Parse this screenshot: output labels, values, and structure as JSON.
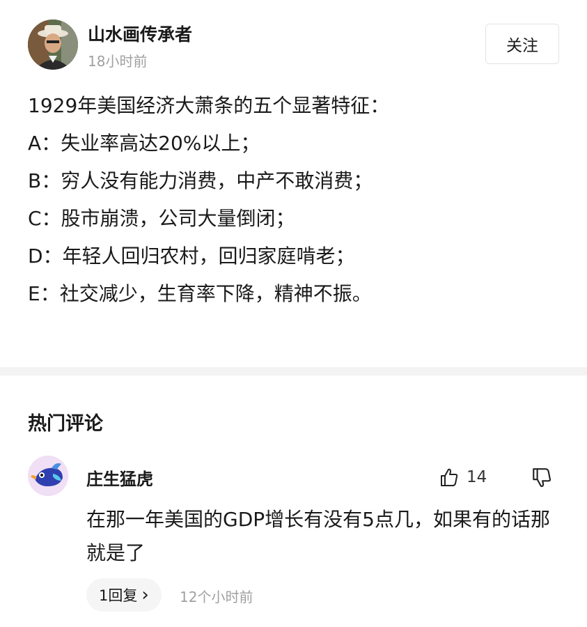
{
  "post": {
    "author": "山水画传承者",
    "time": "18小时前",
    "follow_label": "关注",
    "lines": [
      "1929年美国经济大萧条的五个显著特征：",
      "A：失业率高达20%以上；",
      "B：穷人没有能力消费，中产不敢消费；",
      "C：股市崩溃，公司大量倒闭；",
      "D：年轻人回归农村，回归家庭啃老；",
      "E：社交减少，生育率下降，精神不振。"
    ]
  },
  "comments_section": {
    "title": "热门评论",
    "comments": [
      {
        "author": "庄生猛虎",
        "like_count": "14",
        "text": "在那一年美国的GDP增长有没有5点几，如果有的话那就是了",
        "reply_label": "1回复",
        "reply_chevron": "›",
        "time": "12个小时前"
      }
    ]
  },
  "colors": {
    "background": "#ffffff",
    "text": "#1a1a1a",
    "muted": "#a0a0a0",
    "divider": "#f3f3f3",
    "commenter_avatar_bg": "#f0dff5",
    "commenter_avatar_bird": "#2f3fb0"
  },
  "icons": [
    "user-avatar",
    "thumbs-up-icon",
    "thumbs-down-icon",
    "chevron-right-icon"
  ]
}
